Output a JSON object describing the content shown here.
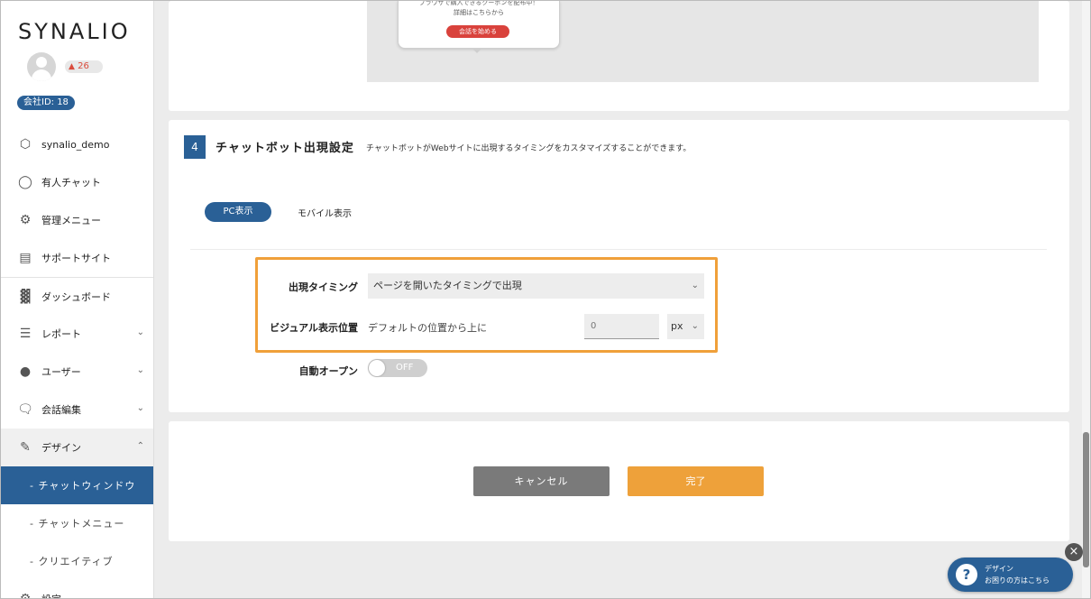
{
  "brand": {
    "logo": "SYNALIO"
  },
  "user": {
    "notifications": "26",
    "company_id": "会社ID: 18"
  },
  "sidebar": {
    "items": [
      {
        "label": "synalio_demo",
        "icon": "cube-icon"
      },
      {
        "label": "有人チャット",
        "icon": "headset-icon"
      },
      {
        "label": "管理メニュー",
        "icon": "gears-icon"
      },
      {
        "label": "サポートサイト",
        "icon": "browser-icon"
      },
      {
        "label": "ダッシュボード",
        "icon": "bar-chart-icon"
      },
      {
        "label": "レポート",
        "icon": "list-icon"
      },
      {
        "label": "ユーザー",
        "icon": "users-icon"
      },
      {
        "label": "会話編集",
        "icon": "chat-icon"
      },
      {
        "label": "デザイン",
        "icon": "edit-icon"
      }
    ],
    "submenu": [
      {
        "label": "- チャットウィンドウ"
      },
      {
        "label": "- チャットメニュー"
      },
      {
        "label": "- クリエイティブ"
      }
    ],
    "last_item": {
      "label": "設定"
    }
  },
  "preview": {
    "line1": "ブラウザで購入できるクーポンを配布中！",
    "line2": "詳細はこちらから",
    "button": "会話を始める"
  },
  "section4": {
    "number": "4",
    "title": "チャットボット出現設定",
    "description": "チャットボットがWebサイトに出現するタイミングをカスタマイズすることができます。",
    "tabs": {
      "pc": "PC表示",
      "mobile": "モバイル表示"
    },
    "timing": {
      "label": "出現タイミング",
      "value": "ページを開いたタイミングで出現"
    },
    "visual": {
      "label": "ビジュアル表示位置",
      "text": "デフォルトの位置から上に",
      "value": "0",
      "unit": "px"
    },
    "auto_open": {
      "label": "自動オープン",
      "state": "OFF"
    }
  },
  "actions": {
    "cancel": "キャンセル",
    "done": "完了"
  },
  "help": {
    "line1": "デザイン",
    "line2": "お困りの方はこちら"
  },
  "colors": {
    "accent": "#2a6096",
    "highlight": "#f0a03a",
    "done": "#eea13a",
    "cancel": "#7a7a7a"
  }
}
